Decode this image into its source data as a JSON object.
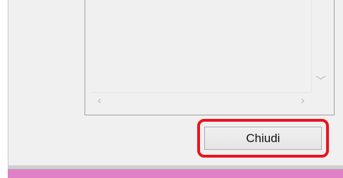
{
  "list_panel": {
    "scroll_down_arrow": "﹀",
    "scroll_left_arrow": "‹",
    "scroll_right_arrow": "›"
  },
  "footer": {
    "close_label": "Chiudi"
  },
  "colors": {
    "window_background": "#f0f0f0",
    "highlight": "#e8141e",
    "taskbar_accent": "#e080c8"
  }
}
